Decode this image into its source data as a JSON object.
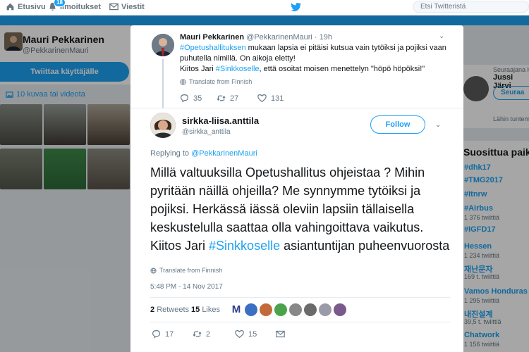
{
  "nav": {
    "home_label": "Etusivu",
    "notifications_label": "Ilmoitukset",
    "notifications_badge": "18",
    "messages_label": "Viestit",
    "search_placeholder": "Etsi Twitteristä"
  },
  "profile": {
    "name": "Mauri Pekkarinen",
    "handle": "@PekkarinenMauri",
    "tweet_to_label": "Twiittaa käyttäjälle",
    "photos_label": "10 kuvaa tai videota"
  },
  "right": {
    "follows_label": "Seuraajana He",
    "name": "Jussi Järvi",
    "follow_label": "Seuraa",
    "unknown_label": "Lähin tuntemiasi h",
    "trends_title": "Suosittua paika",
    "trends": [
      {
        "tag": "#dhk17",
        "count": ""
      },
      {
        "tag": "#TMG2017",
        "count": ""
      },
      {
        "tag": "#Itnrw",
        "count": ""
      },
      {
        "tag": "#Airbus",
        "count": "1 376 twiittiä"
      },
      {
        "tag": "#IGFD17",
        "count": ""
      },
      {
        "tag": "Hessen",
        "count": "1 234 twiittiä"
      },
      {
        "tag": "재난문자",
        "count": "169 t. twiittiä"
      },
      {
        "tag": "Vamos Honduras",
        "count": "1 295 twiittiä"
      },
      {
        "tag": "내진설계",
        "count": "39,5 t. twiittiä"
      },
      {
        "tag": "Chatwork",
        "count": "1 156 twiittiä"
      }
    ]
  },
  "parent_tweet": {
    "name": "Mauri Pekkarinen",
    "meta": "@PekkarinenMauri · 19h",
    "text_link1": "#Opetushallituksen",
    "text_part1": " mukaan lapsia ei pitäisi kutsua vain tytöiksi ja pojiksi vaan puhutella nimillä. On aikoja eletty!",
    "text_part2": "Kiitos Jari ",
    "text_link2": "#Sinkkoselle",
    "text_part3": ", että osoitat moisen menettelyn \"höpö höpöksi!\"",
    "translate_label": "Translate from Finnish",
    "replies": "35",
    "retweets": "27",
    "likes": "131"
  },
  "main_tweet": {
    "name": "sirkka-liisa.anttila",
    "handle": "@sirkka_anttila",
    "follow_label": "Follow",
    "replying_prefix": "Replying to ",
    "replying_handle": "@PekkarinenMauri",
    "text_body": "Millä valtuuksilla Opetushallitus ohjeistaa ? Mihin pyritään näillä ohjeilla? Me synnymme tytöiksi ja pojiksi. Herkässä iässä oleviin lapsiin tällaisella keskustelulla saattaa olla vahingoittava vaikutus. Kiitos Jari ",
    "text_link": "#Sinkkoselle",
    "text_end": " asiantuntijan puheenvuorosta",
    "translate_label": "Translate from Finnish",
    "date": "5:48 PM - 14 Nov 2017",
    "retweets_count": "2",
    "retweets_label": "Retweets",
    "likes_count": "15",
    "likes_label": "Likes",
    "replies": "17",
    "retweets": "2",
    "likes": "15"
  },
  "colors": {
    "accent": "#1da1f2",
    "text": "#14171a",
    "muted": "#657786"
  }
}
